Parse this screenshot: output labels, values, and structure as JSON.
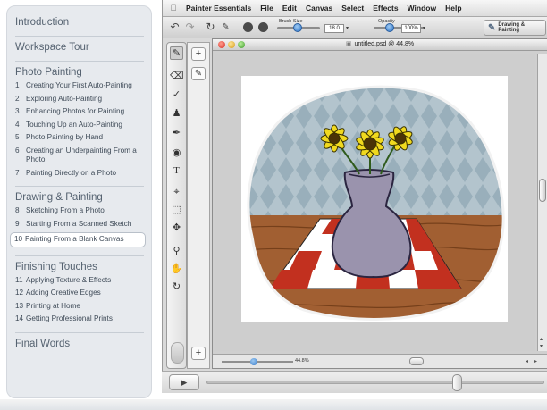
{
  "sidebar": {
    "sections": [
      {
        "title": "Introduction",
        "lessons": []
      },
      {
        "title": "Workspace Tour",
        "lessons": []
      },
      {
        "title": "Photo Painting",
        "lessons": [
          {
            "num": "1",
            "title": "Creating Your First Auto-Painting"
          },
          {
            "num": "2",
            "title": "Exploring Auto-Painting"
          },
          {
            "num": "3",
            "title": "Enhancing Photos for Painting"
          },
          {
            "num": "4",
            "title": "Touching Up an Auto-Painting"
          },
          {
            "num": "5",
            "title": "Photo Painting by Hand"
          },
          {
            "num": "6",
            "title": "Creating an Underpainting From a Photo"
          },
          {
            "num": "7",
            "title": "Painting Directly on a Photo"
          }
        ]
      },
      {
        "title": "Drawing & Painting",
        "lessons": [
          {
            "num": "8",
            "title": "Sketching From a Photo"
          },
          {
            "num": "9",
            "title": "Starting From a Scanned Sketch"
          },
          {
            "num": "10",
            "title": "Painting From a Blank Canvas",
            "active": true
          }
        ]
      },
      {
        "title": "Finishing Touches",
        "lessons": [
          {
            "num": "11",
            "title": "Applying Texture & Effects"
          },
          {
            "num": "12",
            "title": "Adding Creative Edges"
          },
          {
            "num": "13",
            "title": "Printing at Home"
          },
          {
            "num": "14",
            "title": "Getting Professional Prints"
          }
        ]
      },
      {
        "title": "Final Words",
        "lessons": []
      }
    ]
  },
  "menubar": {
    "apple_icon": "apple-icon",
    "app_name": "Painter Essentials",
    "menus": [
      "File",
      "Edit",
      "Canvas",
      "Select",
      "Effects",
      "Window",
      "Help"
    ]
  },
  "propbar": {
    "brush_size_label": "Brush Size",
    "brush_size_value": "18.0",
    "opacity_label": "Opacity",
    "opacity_value": "100%",
    "drawing_button": "Drawing & Painting"
  },
  "document": {
    "title": "untitled.psd @ 44.8%",
    "zoom_value": "44.8%"
  },
  "colors": {
    "wall": "#b3c4cd",
    "diamond": "#99afbb",
    "table": "#a15f32",
    "check_red": "#c2301f",
    "vase": "#9a93ad",
    "petal": "#f0d91e"
  },
  "playback": {
    "position": 0.74
  }
}
